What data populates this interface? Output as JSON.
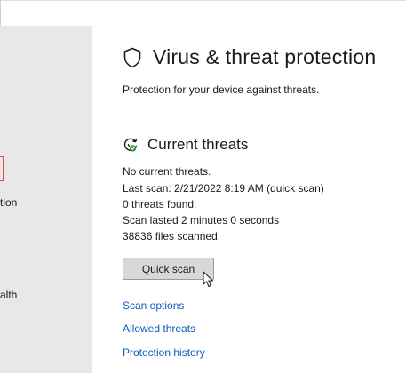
{
  "sidebar": {
    "items": [
      {
        "label": "tion"
      },
      {
        "label": "alth"
      }
    ]
  },
  "main": {
    "title": "Virus & threat protection",
    "subtitle": "Protection for your device against threats.",
    "current_threats": {
      "heading": "Current threats",
      "lines": [
        "No current threats.",
        "Last scan: 2/21/2022 8:19 AM (quick scan)",
        "0 threats found.",
        "Scan lasted 2 minutes 0 seconds",
        "38836 files scanned."
      ],
      "quick_scan_label": "Quick scan"
    },
    "links": [
      "Scan options",
      "Allowed threats",
      "Protection history"
    ]
  },
  "colors": {
    "link": "#0a5cbd",
    "sidebar_bg": "#e8e8e8",
    "selected_marker": "#e24c4c",
    "status_ok": "#2e9c3a"
  },
  "icons": {
    "title": "shield-outline-icon",
    "section": "threat-status-ok-icon",
    "cursor": "mouse-pointer-icon"
  }
}
